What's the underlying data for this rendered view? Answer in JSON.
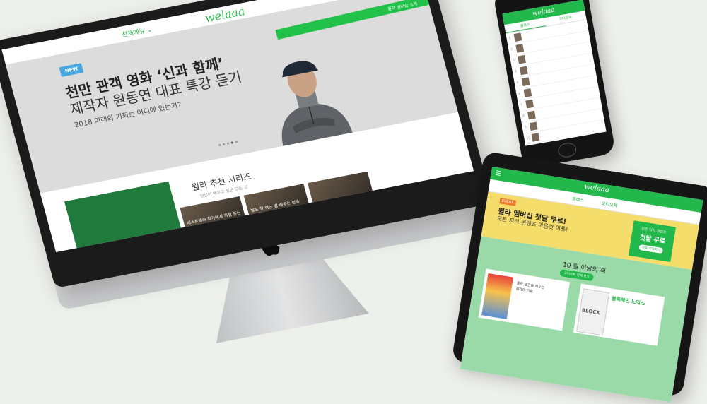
{
  "colors": {
    "brand_green": "#23b84b",
    "promo_yellow": "#f4dd6a",
    "badge_blue": "#48a8e0",
    "book_section_bg": "#9ad9a8"
  },
  "brand": {
    "logo": "welaaa"
  },
  "desktop": {
    "menu_label": "전체메뉴",
    "hero": {
      "badge": "NEW",
      "title_line1": "천만 관객 영화 ‘신과 함께’",
      "title_line2": "제작자 원동연 대표 특강 듣기",
      "subtitle": "2018 미래의 기회는 어디에 있는가?",
      "band_text": "윌라 멤버십 소개"
    },
    "section": {
      "title": "윌라 추천 시리즈",
      "subtitle": "당신이 배우고 싶은 모든 것",
      "thumbs": [
        "베스트셀러 작가에게 직접 듣는",
        "발표 잘 하는 법 배우는 방송",
        ""
      ]
    }
  },
  "phone": {
    "tabs": [
      "클래스",
      "오디오북"
    ],
    "rows": [
      "",
      "",
      "",
      "",
      "",
      "",
      "",
      "",
      "",
      ""
    ]
  },
  "tablet": {
    "tabs": [
      "클래스",
      "오디오북"
    ],
    "promo": {
      "badge": "EVENT",
      "title": "윌라 멤버십 첫달 무료!",
      "subtitle": "모든 지식 콘텐츠 마음껏 이용!",
      "card_top": "모든 지식 콘텐츠",
      "card_main": "첫달 무료",
      "card_button": "무료 시작하기"
    },
    "books": {
      "title": "10 월 이달의 책",
      "pill": "오디오북 전체 보기",
      "card1_text": "좋은 습관을 키우는\n생각의 기술",
      "card2_title": "블록체인 노믹스",
      "card2_cover": "BLOCK"
    }
  }
}
